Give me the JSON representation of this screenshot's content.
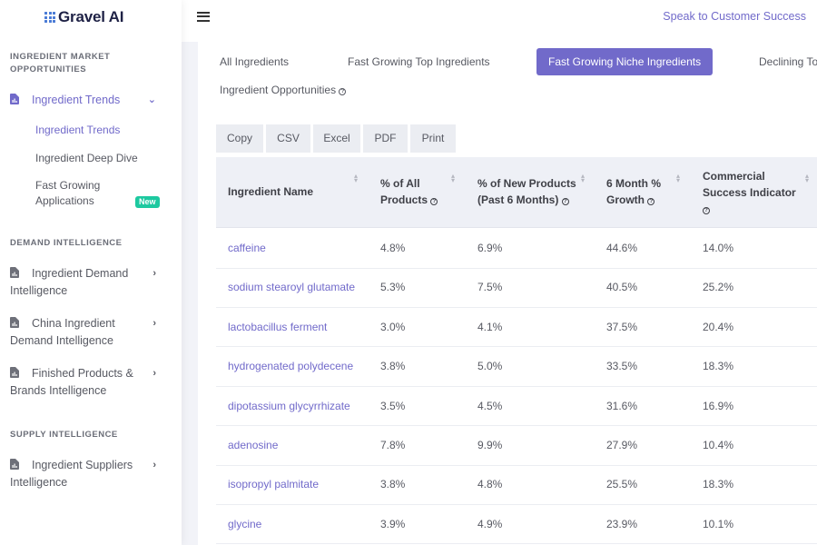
{
  "brand": {
    "name": "Gravel AI",
    "color": "#4a7bd6"
  },
  "colors": {
    "accent": "#716aca",
    "badge": "#1dc9a0"
  },
  "sidebar": {
    "sections": [
      {
        "title_line1": "INGREDIENT MARKET",
        "title_line2": "OPPORTUNITIES"
      },
      {
        "title": "DEMAND INTELLIGENCE"
      },
      {
        "title": "SUPPLY INTELLIGENCE"
      }
    ],
    "ingredient_trends": {
      "label": "Ingredient Trends",
      "sub_items": [
        {
          "label": "Ingredient Trends"
        },
        {
          "label": "Ingredient Deep Dive"
        },
        {
          "label_line1": "Fast Growing",
          "label_line2": "Applications",
          "badge": "New"
        }
      ]
    },
    "items": [
      {
        "label_line1": "Ingredient Demand",
        "label_line2": "Intelligence"
      },
      {
        "label_line1": "China Ingredient",
        "label_line2": "Demand Intelligence"
      },
      {
        "label_line1": "Finished Products &",
        "label_line2": "Brands Intelligence"
      },
      {
        "label_line1": "Ingredient Suppliers",
        "label_line2": "Intelligence"
      }
    ]
  },
  "header": {
    "cs_link": "Speak to Customer Success"
  },
  "tabs": [
    {
      "label": "All Ingredients"
    },
    {
      "label": "Fast Growing Top Ingredients"
    },
    {
      "label": "Fast Growing Niche Ingredients",
      "active": true
    },
    {
      "label": "Declining To"
    },
    {
      "label": "Ingredient Opportunities"
    }
  ],
  "export_buttons": [
    "Copy",
    "CSV",
    "Excel",
    "PDF",
    "Print"
  ],
  "table": {
    "columns": [
      {
        "line1": "Ingredient Name",
        "line2": ""
      },
      {
        "line1": "% of All",
        "line2": "Products"
      },
      {
        "line1": "% of New Products",
        "line2": "(Past 6 Months)"
      },
      {
        "line1": "6 Month %",
        "line2": "Growth"
      },
      {
        "line1": "Commercial",
        "line2": "Success Indicator"
      }
    ],
    "rows": [
      {
        "name": "caffeine",
        "all": "4.8%",
        "new": "6.9%",
        "growth": "44.6%",
        "csi": "14.0%"
      },
      {
        "name": "sodium stearoyl glutamate",
        "all": "5.3%",
        "new": "7.5%",
        "growth": "40.5%",
        "csi": "25.2%"
      },
      {
        "name": "lactobacillus ferment",
        "all": "3.0%",
        "new": "4.1%",
        "growth": "37.5%",
        "csi": "20.4%"
      },
      {
        "name": "hydrogenated polydecene",
        "all": "3.8%",
        "new": "5.0%",
        "growth": "33.5%",
        "csi": "18.3%"
      },
      {
        "name": "dipotassium glycyrrhizate",
        "all": "3.5%",
        "new": "4.5%",
        "growth": "31.6%",
        "csi": "16.9%"
      },
      {
        "name": "adenosine",
        "all": "7.8%",
        "new": "9.9%",
        "growth": "27.9%",
        "csi": "10.4%"
      },
      {
        "name": "isopropyl palmitate",
        "all": "3.8%",
        "new": "4.8%",
        "growth": "25.5%",
        "csi": "18.3%"
      },
      {
        "name": "glycine",
        "all": "3.9%",
        "new": "4.9%",
        "growth": "23.9%",
        "csi": "10.1%"
      }
    ]
  }
}
